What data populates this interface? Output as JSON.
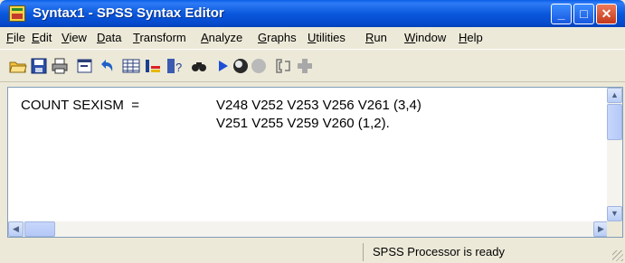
{
  "window": {
    "title": "Syntax1 - SPSS Syntax Editor",
    "title_color": "#ffffff",
    "titlebar_color": "#0a58dc",
    "buttons": {
      "minimize": "_",
      "maximize": "□",
      "close": "✕"
    }
  },
  "menubar": {
    "items": [
      "File",
      "Edit",
      "View",
      "Data",
      "Transform",
      "Analyze",
      "Graphs",
      "Utilities",
      "Run",
      "Window",
      "Help"
    ]
  },
  "toolbar": {
    "icons": [
      "open-folder-icon",
      "save-icon",
      "print-icon",
      "dialog-recall-icon",
      "undo-icon",
      "goto-data-icon",
      "variables-icon",
      "help-icon",
      "find-icon",
      "run-icon",
      "designate-window-icon",
      "use-sets-icon",
      "value-labels-icon",
      "insert-icon"
    ]
  },
  "editor": {
    "lines": [
      {
        "keyword": "COUNT SEXISM  =",
        "text": "V248 V252 V253 V256 V261 (3,4)"
      },
      {
        "keyword": "",
        "text": "V251 V255 V259 V260 (1,2)."
      }
    ]
  },
  "statusbar": {
    "text": "SPSS Processor  is ready"
  }
}
